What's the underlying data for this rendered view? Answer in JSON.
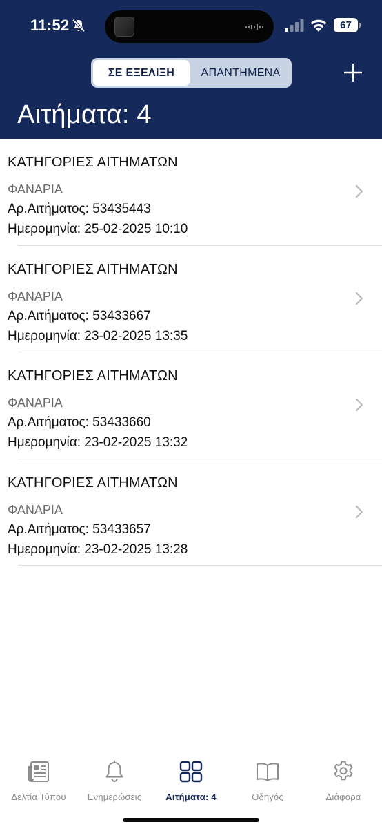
{
  "status_bar": {
    "time": "11:52",
    "battery": "67"
  },
  "header": {
    "segments": [
      "ΣΕ ΕΞΕΛΙΞΗ",
      "ΑΠΑΝΤΗΜΕΝΑ"
    ],
    "selected_segment": "ΣΕ ΕΞΕΛΙΞΗ",
    "title": "Αιτήματα: 4",
    "add_icon": "plus-icon"
  },
  "requests": [
    {
      "category": "ΚΑΤΗΓΟΡΙΕΣ ΑΙΤΗΜΑΤΩΝ",
      "subcategory": "ΦΑΝΑΡΙΑ",
      "number": "Αρ.Αιτήματος: 53435443",
      "date": "Ημερομηνία: 25-02-2025 10:10"
    },
    {
      "category": "ΚΑΤΗΓΟΡΙΕΣ ΑΙΤΗΜΑΤΩΝ",
      "subcategory": "ΦΑΝΑΡΙΑ",
      "number": "Αρ.Αιτήματος: 53433667",
      "date": "Ημερομηνία: 23-02-2025 13:35"
    },
    {
      "category": "ΚΑΤΗΓΟΡΙΕΣ ΑΙΤΗΜΑΤΩΝ",
      "subcategory": "ΦΑΝΑΡΙΑ",
      "number": "Αρ.Αιτήματος: 53433660",
      "date": "Ημερομηνία: 23-02-2025 13:32"
    },
    {
      "category": "ΚΑΤΗΓΟΡΙΕΣ ΑΙΤΗΜΑΤΩΝ",
      "subcategory": "ΦΑΝΑΡΙΑ",
      "number": "Αρ.Αιτήματος: 53433657",
      "date": "Ημερομηνία: 23-02-2025 13:28"
    }
  ],
  "tabbar": {
    "tabs": [
      {
        "label": "Δελτία Τύπου",
        "icon": "newspaper-icon"
      },
      {
        "label": "Ενημερώσεις",
        "icon": "bell-icon"
      },
      {
        "label": "Αιτήματα: 4",
        "icon": "grid-icon"
      },
      {
        "label": "Οδηγός",
        "icon": "book-icon"
      },
      {
        "label": "Διάφορα",
        "icon": "gear-icon"
      }
    ],
    "active_tab": "Αιτήματα: 4"
  },
  "colors": {
    "header_bg": "#15295a",
    "segment_bg": "#c8d3e4",
    "active_tab": "#15295a",
    "inactive_tab": "#8c8c8c"
  }
}
